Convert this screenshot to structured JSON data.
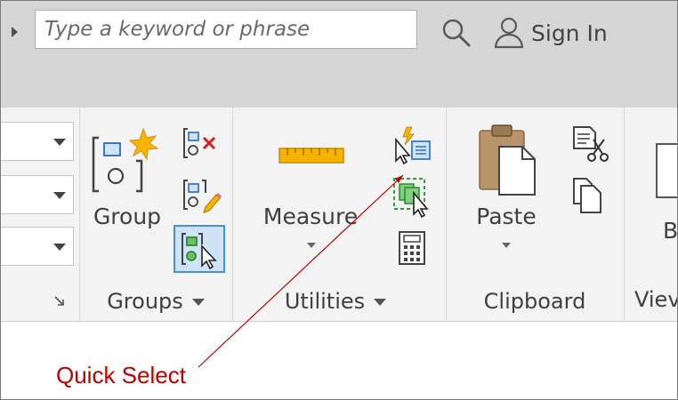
{
  "search": {
    "placeholder": "Type a keyword or phrase"
  },
  "account": {
    "signin_label": "Sign In"
  },
  "ribbon": {
    "groups_panel": {
      "group_button_label": "Group",
      "label": "Groups"
    },
    "utilities_panel": {
      "measure_button_label": "Measure",
      "label": "Utilities"
    },
    "clipboard_panel": {
      "paste_button_label": "Paste",
      "label": "Clipboard"
    },
    "view_panel": {
      "label_partial": "Viev",
      "button_partial": "B"
    }
  },
  "icons": {
    "search": "magnifier-icon",
    "user": "user-icon",
    "group_create": "group-create-icon",
    "ungroup": "ungroup-icon",
    "group_edit": "group-edit-icon",
    "group_select": "group-select-icon",
    "measure": "ruler-icon",
    "quick_select": "quick-select-icon",
    "select_similar": "select-similar-icon",
    "calculator": "calculator-icon",
    "paste": "clipboard-paste-icon",
    "cut": "cut-icon",
    "copy": "copy-icon"
  },
  "annotation": {
    "text": "Quick Select"
  },
  "colors": {
    "annotation": "#c00000",
    "selected_border": "#4a90d9",
    "selected_fill": "#cfe3f7",
    "ruler": "#f5b300",
    "select_similar": "#2e9e3e"
  }
}
